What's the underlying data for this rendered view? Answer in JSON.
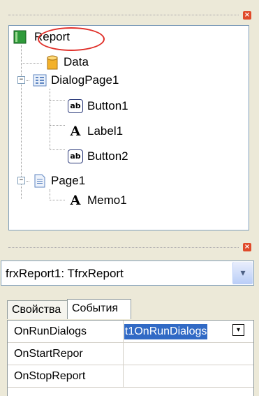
{
  "tree_panel": {
    "nodes": [
      {
        "label": "Report",
        "icon": "report-icon"
      },
      {
        "label": "Data",
        "icon": "database-icon"
      },
      {
        "label": "DialogPage1",
        "icon": "dialog-page-icon"
      },
      {
        "label": "Button1",
        "icon": "button-component-icon"
      },
      {
        "label": "Label1",
        "icon": "label-component-icon"
      },
      {
        "label": "Button2",
        "icon": "button-component-icon"
      },
      {
        "label": "Page1",
        "icon": "page-icon"
      },
      {
        "label": "Memo1",
        "icon": "memo-component-icon"
      }
    ],
    "highlight_color": "#e0302a",
    "expander_minus": "−"
  },
  "inspector": {
    "object_selector": "frxReport1: TfrxReport",
    "tabs": [
      "Свойства",
      "События"
    ],
    "rows": [
      {
        "name": "OnRunDialogs",
        "value": "t1OnRunDialogs"
      },
      {
        "name": "OnStartRepor",
        "value": ""
      },
      {
        "name": "OnStopReport",
        "value": ""
      }
    ],
    "selection_color": "#316ac5"
  },
  "close_glyph": "×",
  "icons": {
    "ab": "ab",
    "A": "A",
    "dropdown": "▾"
  }
}
